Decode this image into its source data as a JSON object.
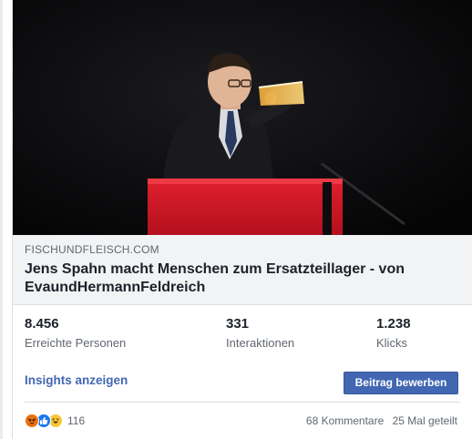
{
  "post": {
    "domain": "FISCHUNDFLEISCH.COM",
    "headline": "Jens Spahn macht Menschen zum Ersatzteillager - von EvaundHermannFeldreich"
  },
  "stats": [
    {
      "value": "8.456",
      "label": "Erreichte Personen"
    },
    {
      "value": "331",
      "label": "Interaktionen"
    },
    {
      "value": "1.238",
      "label": "Klicks"
    }
  ],
  "actions": {
    "insights_label": "Insights anzeigen",
    "promote_label": "Beitrag bewerben"
  },
  "reactions": {
    "icons": [
      "angry-icon",
      "like-icon",
      "haha-icon"
    ],
    "count": "116"
  },
  "footer": {
    "comments": "68 Kommentare",
    "shares": "25 Mal geteilt"
  },
  "colors": {
    "accent": "#4267b2",
    "link_background": "#f2f3f5",
    "podium_red": "#c8102e"
  }
}
